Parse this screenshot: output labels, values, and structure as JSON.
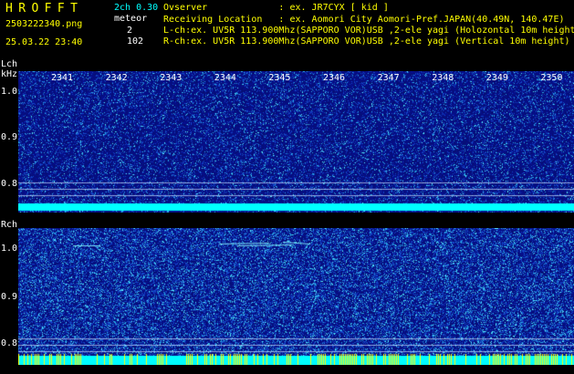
{
  "header": {
    "title": "HROFFT",
    "filename": "2503222340.png",
    "datetime": "25.03.22 23:40",
    "mode": "2ch 0.30",
    "meteor_label": "meteor",
    "meteor_counts": [
      "2",
      "102"
    ]
  },
  "info": {
    "lines": [
      "Ovserver             : ex. JR7CYX [ kid ]",
      "Receiving Location   : ex. Aomori City Aomori-Pref.JAPAN(40.49N, 140.47E)",
      "L-ch:ex. UV5R 113.900Mhz(SAPPORO VOR)USB ,2-ele yagi (Holozontal 10m height)",
      "R-ch:ex. UV5R 113.900Mhz(SAPPORO VOR)USB ,2-ele yagi (Vertical 10m height)"
    ]
  },
  "time_axis": {
    "ticks": [
      "2341",
      "2342",
      "2343",
      "2344",
      "2345",
      "2346",
      "2347",
      "2348",
      "2349",
      "2350"
    ]
  },
  "lch": {
    "label": "Lch",
    "unit": "kHz",
    "yticks": [
      "1.0",
      "0.9",
      "0.8"
    ],
    "meteor_pings": 2
  },
  "rch": {
    "label": "Rch",
    "yticks": [
      "1.0",
      "0.9",
      "0.8"
    ],
    "meteor_pings": 102
  },
  "colors": {
    "background": "#000000",
    "noise_base": "#07107a",
    "noise_bright": "#00ffff",
    "label_yellow": "#ffff00",
    "label_cyan": "#00ffff",
    "baseline_yellow": "#ffff00"
  }
}
